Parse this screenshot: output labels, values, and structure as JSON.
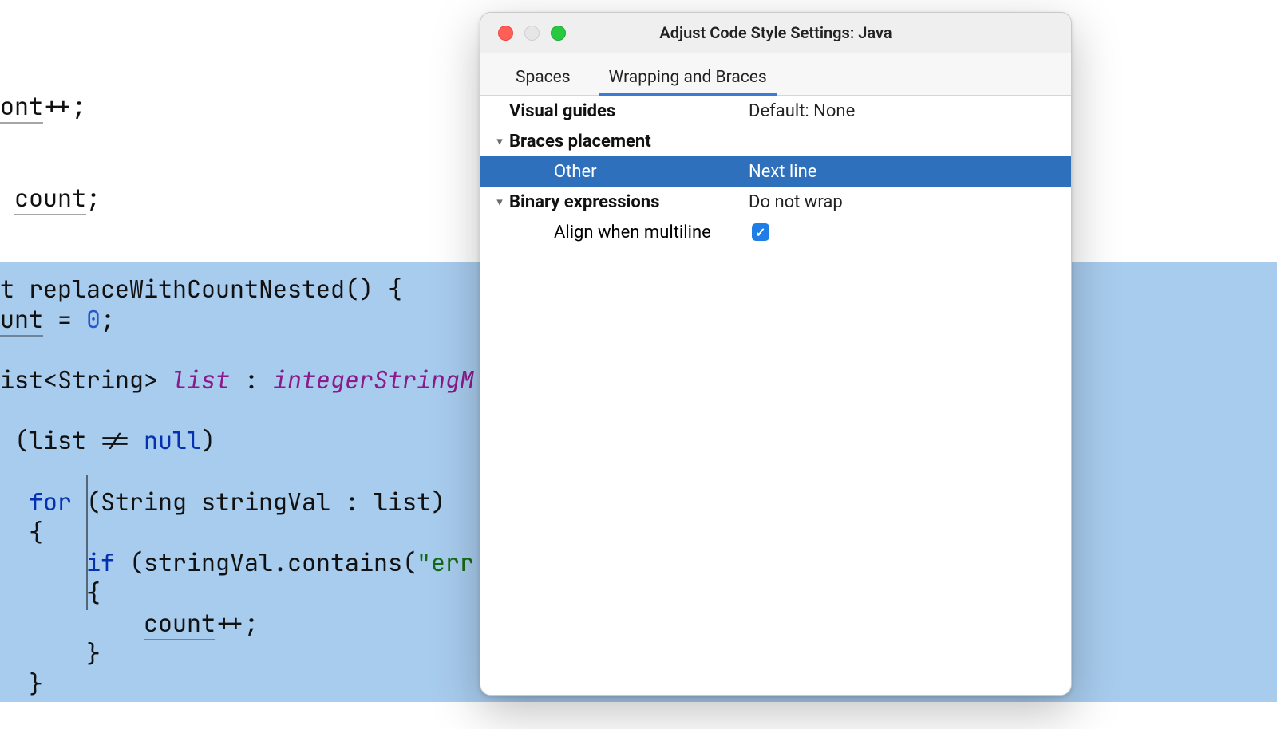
{
  "editor": {
    "frag_ont_pp": "ont",
    "frag_pp": "++;",
    "count_stmt": "count",
    "semicolon": ";",
    "fn_decl_pre": "t ",
    "fn_name": "replaceWithCountNested",
    "fn_decl_post": "() {",
    "unt_eq": "unt",
    "eq": " = ",
    "zero": "0",
    "sc": ";",
    "ist_string_pre": "ist<String> ",
    "list_var": "list",
    "colon": " : ",
    "integer_string": "integerStringM",
    "if_open": " (",
    "null_kw": "null",
    "if_close": ")",
    "neq": " != ",
    "for_kw": "for",
    "for_args": " (String stringVal : list)",
    "brace_open": "{",
    "if_kw": "if",
    "contains_call": " (stringVal.contains(",
    "err_str": "\"err",
    "count_inner": "count",
    "pp": "++;",
    "brace_close": "}"
  },
  "popup": {
    "title": "Adjust Code Style Settings: Java",
    "tabs": {
      "spaces": "Spaces",
      "wrapping": "Wrapping and Braces"
    },
    "rows": {
      "visual_guides": {
        "label": "Visual guides",
        "value": "Default: None"
      },
      "braces_placement": {
        "label": "Braces placement"
      },
      "other": {
        "label": "Other",
        "value": "Next line"
      },
      "binary_expr": {
        "label": "Binary expressions",
        "value": "Do not wrap"
      },
      "align_multiline": {
        "label": "Align when multiline"
      }
    }
  }
}
